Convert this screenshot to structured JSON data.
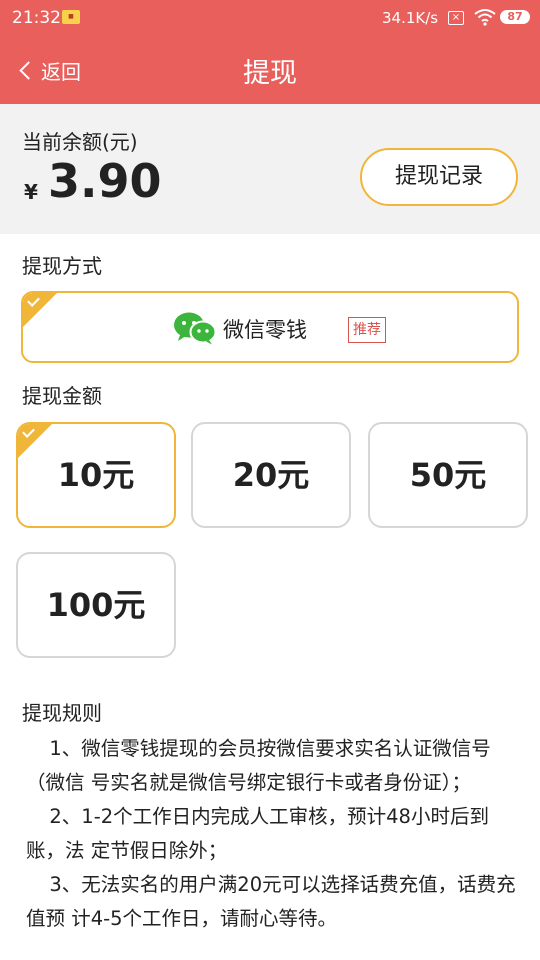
{
  "status_bar": {
    "time": "21:32",
    "speed": "34.1K/s",
    "battery": "87",
    "color": "#e85f5b"
  },
  "header": {
    "back_label": "返回",
    "title": "提现"
  },
  "balance": {
    "label": "当前余额(元)",
    "currency": "¥",
    "amount": "3.90",
    "record_button": "提现记录"
  },
  "method_section": {
    "title": "提现方式",
    "method_name": "微信零钱",
    "badge": "推荐",
    "icon": "wechat-icon",
    "selected": true
  },
  "amount_section": {
    "title": "提现金额",
    "options": [
      {
        "label": "10元",
        "selected": true
      },
      {
        "label": "20元",
        "selected": false
      },
      {
        "label": "50元",
        "selected": false
      },
      {
        "label": "100元",
        "selected": false
      }
    ]
  },
  "rules": {
    "title": "提现规则",
    "items": [
      "1、微信零钱提现的会员按微信要求实名认证微信号（微信 号实名就是微信号绑定银行卡或者身份证）；",
      "2、1-2个工作日内完成人工审核，预计48小时后到账，法 定节假日除外；",
      "3、无法实名的用户满20元可以选择话费充值，话费充值预 计4-5个工作日，请耐心等待。"
    ]
  },
  "accent_color": "#f0b63a"
}
